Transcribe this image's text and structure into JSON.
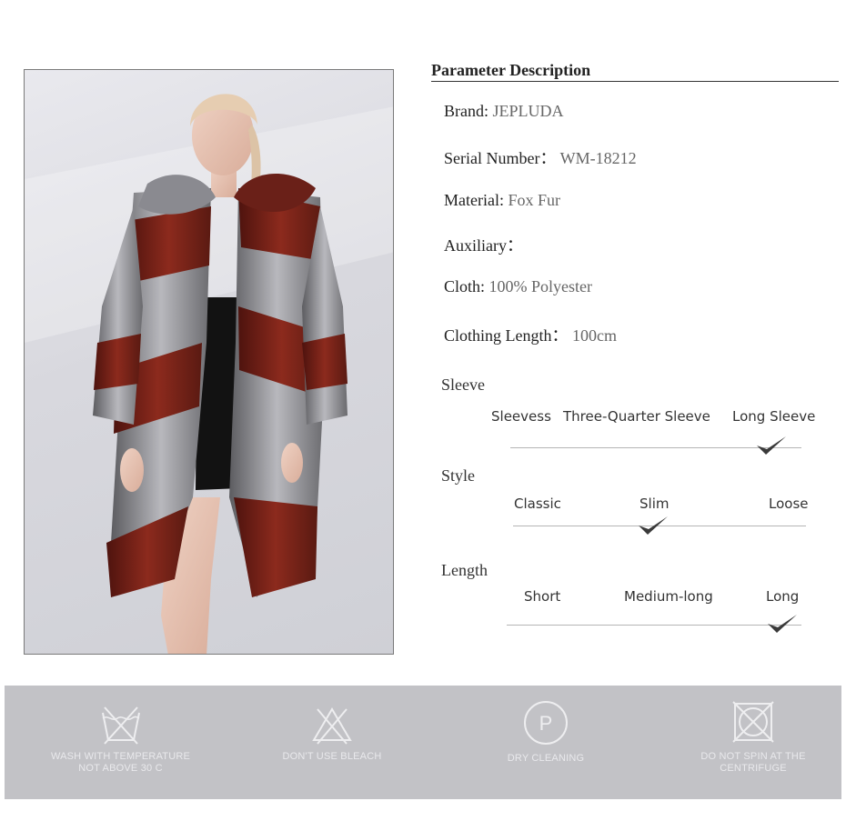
{
  "parameters": {
    "title": "Parameter Description",
    "specs": [
      {
        "label": "Brand:",
        "value": "JEPLUDA"
      },
      {
        "label": "Serial Number：",
        "value": "WM-18212"
      },
      {
        "label": "Material:",
        "value": "Fox Fur"
      },
      {
        "label": "Auxiliary：",
        "value": ""
      },
      {
        "label": "Cloth:",
        "value": "100% Polyester"
      },
      {
        "label": "Clothing Length：",
        "value": "100cm"
      }
    ]
  },
  "scales": [
    {
      "title": "Sleeve",
      "options": [
        "Sleevess",
        "Three-Quarter Sleeve",
        "Long Sleeve"
      ],
      "selected": "Long Sleeve"
    },
    {
      "title": "Style",
      "options": [
        "Classic",
        "Slim",
        "Loose"
      ],
      "selected": "Slim"
    },
    {
      "title": "Length",
      "options": [
        "Short",
        "Medium-long",
        "Long"
      ],
      "selected": "Long"
    }
  ],
  "care": [
    {
      "icon": "wash-30-icon",
      "line1": "WASH WITH TEMPERATURE",
      "line2": "NOT ABOVE 30 C"
    },
    {
      "icon": "no-bleach-icon",
      "line1": "DON'T USE BLEACH",
      "line2": ""
    },
    {
      "icon": "dry-clean-p-icon",
      "symbol": "P",
      "line1": "DRY CLEANING",
      "line2": ""
    },
    {
      "icon": "no-tumble-dry-icon",
      "line1": "DO NOT SPIN AT THE",
      "line2": "CENTRIFUGE"
    }
  ],
  "colors": {
    "accent_check": "#3a3a3a",
    "care_band": "#c2c2c6",
    "fur_red": "#7a2218",
    "fur_silver": "#9a9aa0"
  }
}
